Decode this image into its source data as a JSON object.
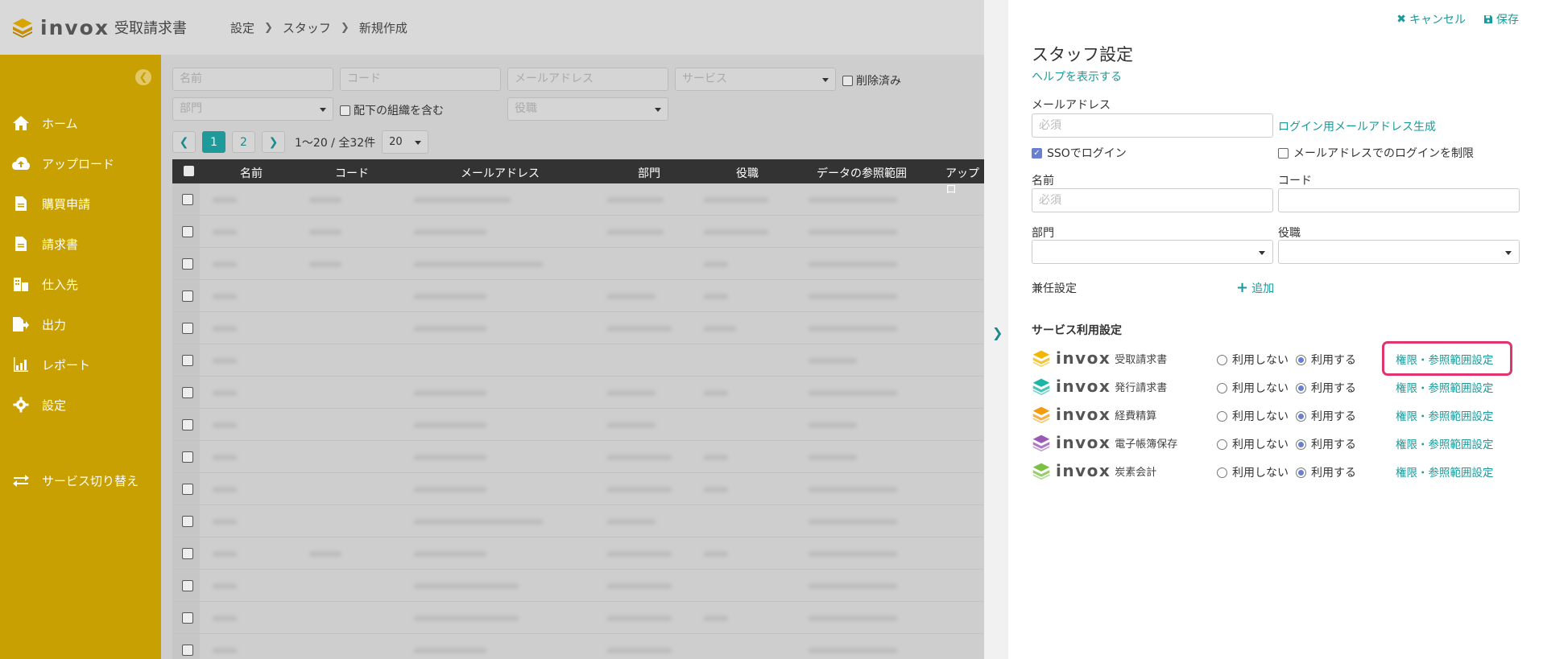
{
  "app": {
    "logo_word": "invox",
    "logo_sub": "受取請求書"
  },
  "breadcrumb": [
    "設定",
    "スタッフ",
    "新規作成"
  ],
  "sidebar": {
    "items": [
      {
        "label": "ホーム",
        "icon": "home-icon"
      },
      {
        "label": "アップロード",
        "icon": "cloud-upload-icon"
      },
      {
        "label": "購買申請",
        "icon": "document-icon"
      },
      {
        "label": "請求書",
        "icon": "invoice-icon"
      },
      {
        "label": "仕入先",
        "icon": "building-icon"
      },
      {
        "label": "出力",
        "icon": "export-icon"
      },
      {
        "label": "レポート",
        "icon": "chart-icon"
      },
      {
        "label": "設定",
        "icon": "gear-icon"
      }
    ],
    "switch_label": "サービス切り替え"
  },
  "filters": {
    "name_placeholder": "名前",
    "code_placeholder": "コード",
    "email_placeholder": "メールアドレス",
    "service_placeholder": "サービス",
    "deleted_label": "削除済み",
    "dept_placeholder": "部門",
    "include_sub_label": "配下の組織を含む",
    "role_placeholder": "役職"
  },
  "pager": {
    "pages": [
      "1",
      "2"
    ],
    "summary": "1〜20 / 全32件",
    "per_page": "20"
  },
  "table": {
    "headers": [
      "名前",
      "コード",
      "メールアドレス",
      "部門",
      "役職",
      "データの参照範囲",
      "アップロ"
    ]
  },
  "panel": {
    "cancel_label": "キャンセル",
    "save_label": "保存",
    "title": "スタッフ設定",
    "help_link": "ヘルプを表示する",
    "email_label": "メールアドレス",
    "email_placeholder": "必須",
    "generate_link": "ログイン用メールアドレス生成",
    "sso_label": "SSOでログイン",
    "sso_checked": true,
    "restrict_label": "メールアドレスでのログインを制限",
    "restrict_checked": false,
    "name_label": "名前",
    "name_placeholder": "必須",
    "code_label": "コード",
    "dept_label": "部門",
    "role_label": "役職",
    "concurrent_label": "兼任設定",
    "add_label": "追加",
    "service_section": "サービス利用設定",
    "radio_off": "利用しない",
    "radio_on": "利用する",
    "perm_link": "権限・参照範囲設定",
    "services": [
      {
        "word": "invox",
        "name": "受取請求書",
        "color": "#f2b705",
        "selected": "on"
      },
      {
        "word": "invox",
        "name": "発行請求書",
        "color": "#1bb5a8",
        "selected": "on"
      },
      {
        "word": "invox",
        "name": "経費精算",
        "color": "#f39c12",
        "selected": "on"
      },
      {
        "word": "invox",
        "name": "電子帳簿保存",
        "color": "#9b59b6",
        "selected": "on"
      },
      {
        "word": "invox",
        "name": "炭素会計",
        "color": "#7cc242",
        "selected": "on"
      }
    ]
  },
  "colors": {
    "accent": "#1a9a9a",
    "sidebar": "#c9a002",
    "highlight": "#e0336f",
    "radio": "#6b7fd0"
  }
}
